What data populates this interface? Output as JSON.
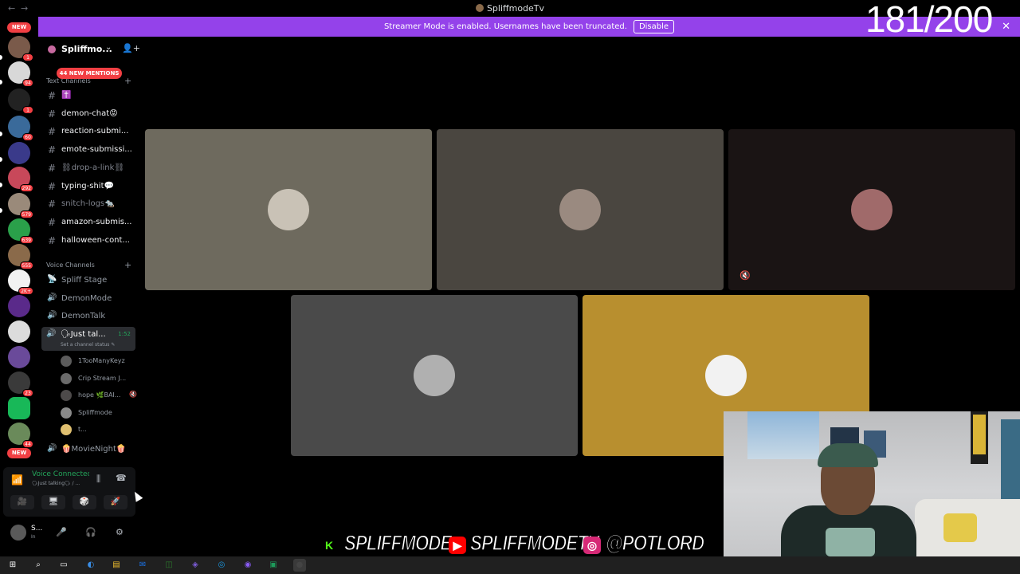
{
  "window": {
    "title": "SpliffmodeTv",
    "back_glyph": "←",
    "forward_glyph": "→"
  },
  "banner": {
    "message": "Streamer Mode is enabled. Usernames have been truncated.",
    "disable_label": "Disable",
    "close_glyph": "✕"
  },
  "overlay_counter": "181/200",
  "rail": {
    "new_top": "NEW",
    "new_bottom": "NEW",
    "badges": [
      "1",
      "94",
      "1",
      "60",
      "",
      "292",
      "579",
      "639",
      "555",
      "2K+",
      "",
      "",
      "",
      "23",
      "",
      "44"
    ],
    "server_colors": [
      "#7a5a4a",
      "#d8d8d8",
      "#222222",
      "#3a6a9a",
      "#3a3a8a",
      "#c8485a",
      "#9a8a7a",
      "#2aa04a",
      "#8a6a4a",
      "#f2f2f2",
      "#5a2a8a",
      "#dcdcdc",
      "#6a4a9a",
      "#3a3a3a",
      "#18b858",
      "#6a8a5a"
    ]
  },
  "server": {
    "name": "Spliffmo...",
    "chevron": "⌄",
    "invite_glyph": "👤+",
    "mentions_label": "44 NEW MENTIONS"
  },
  "text_category": {
    "label": "Text Channels",
    "plus": "+"
  },
  "text_channels": [
    {
      "label": "✝️",
      "unread": false,
      "dim": false
    },
    {
      "label": "demon-chat😡",
      "unread": true,
      "dim": false
    },
    {
      "label": "reaction-submi...",
      "unread": true,
      "dim": false
    },
    {
      "label": "emote-submissi...",
      "unread": true,
      "dim": false
    },
    {
      "label": "⛓drop-a-link⛓",
      "unread": false,
      "dim": true
    },
    {
      "label": "typing-shit💬",
      "unread": true,
      "dim": false
    },
    {
      "label": "snitch-logs🐀",
      "unread": false,
      "dim": true
    },
    {
      "label": "amazon-submis...",
      "unread": true,
      "dim": false
    },
    {
      "label": "halloween-cont...",
      "unread": true,
      "dim": false
    }
  ],
  "voice_category": {
    "label": "Voice Channels",
    "plus": "+"
  },
  "voice_channels": [
    {
      "label": "Spliff Stage",
      "icon": "📡"
    },
    {
      "label": "DemonMode",
      "icon": "🔊"
    },
    {
      "label": "DemonTalk",
      "icon": "🔊"
    }
  ],
  "active_voice": {
    "label": "🗣Just tal...",
    "time": "1:52",
    "status": "Set a channel status ✎",
    "icon": "🔊"
  },
  "members": [
    {
      "name": "1TooManyKeyz",
      "color": "#5c5c5c"
    },
    {
      "name": "Crip Stream J...",
      "color": "#6b6b6b"
    },
    {
      "name": "hope 🌿BAI...",
      "color": "#4d4a4a",
      "extra": "🔇"
    },
    {
      "name": "Spliffmode",
      "color": "#8a8a8a"
    },
    {
      "name": "t...",
      "color": "#e0c070"
    }
  ],
  "movie_channel": {
    "label": "🍿MovieNight🍿",
    "icon": "🔊"
  },
  "voice_panel": {
    "title": "Voice Connected",
    "subtitle": "🗣Just talking🗣 / ...",
    "signal_glyph": "📶",
    "wave_glyph": "⫼",
    "hangup_glyph": "☎",
    "buttons": [
      "🎥",
      "🖥",
      "🎲",
      "🚀"
    ]
  },
  "user": {
    "name": "S...",
    "status": "In",
    "mic": "🎤",
    "headset": "🎧",
    "settings": "⚙"
  },
  "tiles": [
    {
      "bg": "#6e6a5e",
      "avatar": "#c9c2b6"
    },
    {
      "bg": "#4a4640",
      "avatar": "#9a8a80"
    },
    {
      "bg": "#1a1414",
      "avatar": "#a06a6a",
      "muted": "🔇"
    },
    {
      "bg": "#4a4a4a",
      "avatar": "#b0b0b0"
    },
    {
      "bg": "#b88f2f",
      "avatar": "#f2f2f2"
    }
  ],
  "socials": {
    "kick_glyph": "K",
    "kick_handle": "SPLIFFMODE",
    "youtube_glyph": "▶",
    "youtube_handle": "SPLIFFMODETV",
    "instagram_glyph": "◎",
    "instagram_handle": "@POTLORD",
    "colors": {
      "kick": "#53fc18",
      "youtube": "#ff0000",
      "instagram": "#d62976"
    }
  },
  "taskbar": {
    "icons": [
      "⊞",
      "⌕",
      "▭",
      "◐",
      "▤",
      "✉",
      "◫",
      "◈",
      "◎",
      "◉",
      "▣",
      "●"
    ]
  },
  "colors": {
    "accent_purple": "#9442ea",
    "danger": "#f23f43",
    "online_green": "#23a55a"
  }
}
